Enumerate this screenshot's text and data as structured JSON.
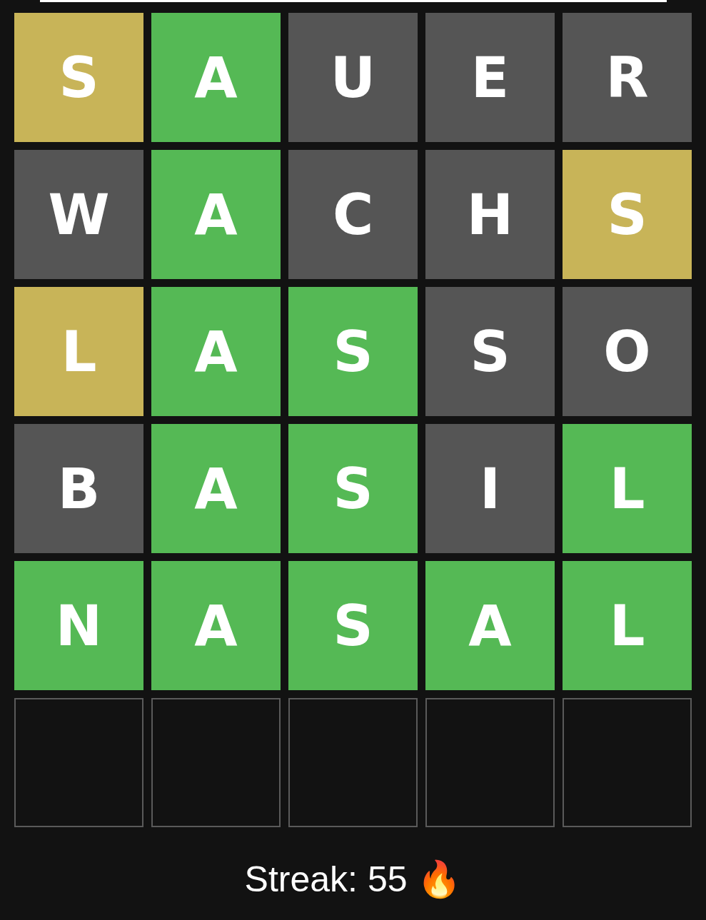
{
  "board": {
    "rows": [
      {
        "tiles": [
          {
            "letter": "S",
            "kind": "present"
          },
          {
            "letter": "A",
            "kind": "correct"
          },
          {
            "letter": "U",
            "kind": "absent"
          },
          {
            "letter": "E",
            "kind": "absent"
          },
          {
            "letter": "R",
            "kind": "absent"
          }
        ]
      },
      {
        "tiles": [
          {
            "letter": "W",
            "kind": "absent"
          },
          {
            "letter": "A",
            "kind": "correct"
          },
          {
            "letter": "C",
            "kind": "absent"
          },
          {
            "letter": "H",
            "kind": "absent"
          },
          {
            "letter": "S",
            "kind": "present"
          }
        ]
      },
      {
        "tiles": [
          {
            "letter": "L",
            "kind": "present"
          },
          {
            "letter": "A",
            "kind": "correct"
          },
          {
            "letter": "S",
            "kind": "correct"
          },
          {
            "letter": "S",
            "kind": "absent"
          },
          {
            "letter": "O",
            "kind": "absent"
          }
        ]
      },
      {
        "tiles": [
          {
            "letter": "B",
            "kind": "absent"
          },
          {
            "letter": "A",
            "kind": "correct"
          },
          {
            "letter": "S",
            "kind": "correct"
          },
          {
            "letter": "I",
            "kind": "absent"
          },
          {
            "letter": "L",
            "kind": "correct"
          }
        ]
      },
      {
        "tiles": [
          {
            "letter": "N",
            "kind": "correct"
          },
          {
            "letter": "A",
            "kind": "correct"
          },
          {
            "letter": "S",
            "kind": "correct"
          },
          {
            "letter": "A",
            "kind": "correct"
          },
          {
            "letter": "L",
            "kind": "correct"
          }
        ]
      },
      {
        "tiles": [
          {
            "kind": "empty"
          },
          {
            "kind": "empty"
          },
          {
            "kind": "empty"
          },
          {
            "kind": "empty"
          },
          {
            "kind": "empty"
          }
        ]
      }
    ]
  },
  "streak": "Streak: 55 🔥"
}
